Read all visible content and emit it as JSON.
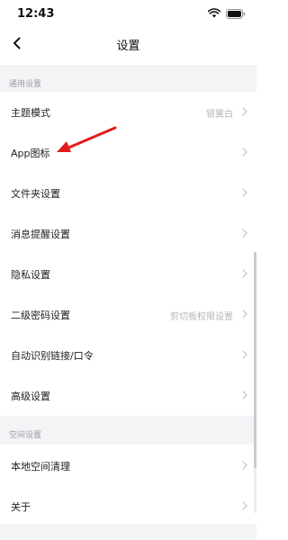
{
  "status_bar": {
    "time": "12:43"
  },
  "nav": {
    "title": "设置"
  },
  "sections": {
    "general": {
      "header": "通用设置",
      "items": [
        {
          "label": "主题模式",
          "value": "银翼白"
        },
        {
          "label": "App图标",
          "value": ""
        },
        {
          "label": "文件夹设置",
          "value": ""
        },
        {
          "label": "消息提醒设置",
          "value": ""
        },
        {
          "label": "隐私设置",
          "value": ""
        },
        {
          "label": "二级密码设置",
          "value": "剪切板权限设置"
        },
        {
          "label": "自动识别链接/口令",
          "value": ""
        },
        {
          "label": "高级设置",
          "value": ""
        }
      ]
    },
    "space": {
      "header": "空间设置",
      "items": [
        {
          "label": "本地空间清理",
          "value": ""
        },
        {
          "label": "关于",
          "value": ""
        }
      ]
    }
  },
  "colors": {
    "annotation_arrow": "#e21b1b",
    "section_background": "#f3f4f6"
  },
  "icons": [
    "back-chevron-icon",
    "wifi-icon",
    "battery-icon",
    "chevron-right-icon"
  ]
}
